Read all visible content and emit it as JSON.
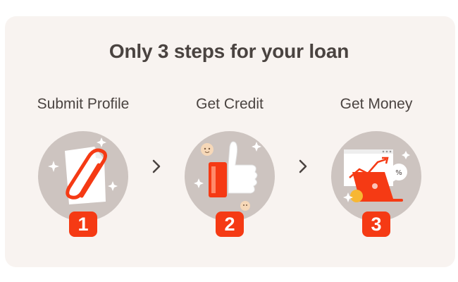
{
  "heading": "Only 3 steps for your loan",
  "steps": [
    {
      "label": "Submit Profile",
      "number": "1",
      "icon": "paperclip-document-icon"
    },
    {
      "label": "Get Credit",
      "number": "2",
      "icon": "thumbs-up-icon"
    },
    {
      "label": "Get Money",
      "number": "3",
      "icon": "laptop-growth-chart-icon"
    }
  ],
  "separator_icon": "chevron-right-icon",
  "colors": {
    "card": "#f8f3f0",
    "accent": "#f53a14",
    "text": "#4a4340",
    "disc": "#cdc4c0"
  }
}
